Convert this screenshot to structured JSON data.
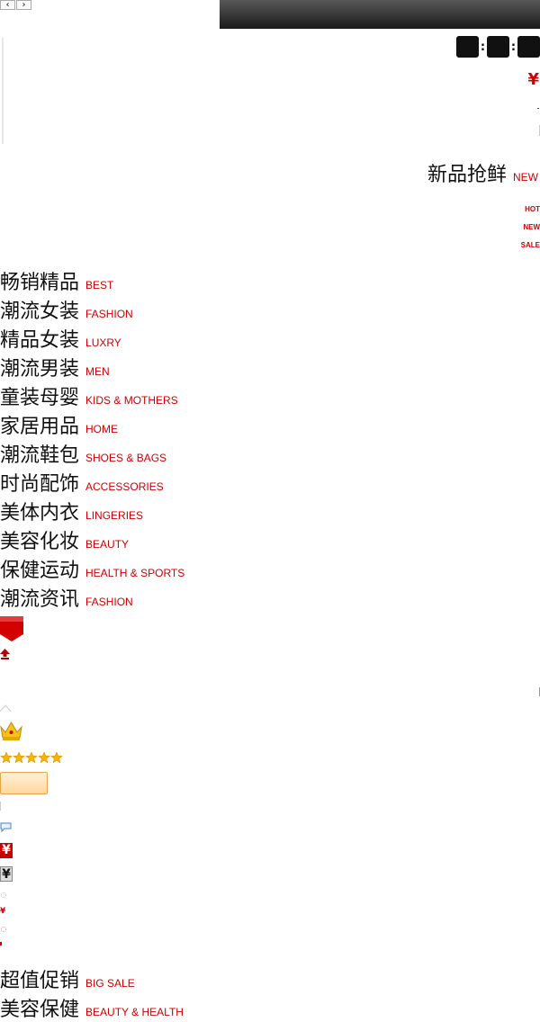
{
  "nav": {
    "prev": "‹",
    "next": "›"
  },
  "countdown": {
    "colon1": ":",
    "colon2": ":"
  },
  "price": {
    "currency": "¥"
  },
  "new_section": {
    "zh": "新品抢鲜",
    "en": "NEW",
    "tags": [
      "HOT",
      "NEW",
      "SALE"
    ]
  },
  "categories": [
    {
      "zh": "畅销精品",
      "en": "BEST"
    },
    {
      "zh": "潮流女装",
      "en": "FASHION"
    },
    {
      "zh": "精品女装",
      "en": "LUXRY"
    },
    {
      "zh": "潮流男装",
      "en": "MEN"
    },
    {
      "zh": "童装母婴",
      "en": "KIDS & MOTHERS"
    },
    {
      "zh": "家居用品",
      "en": "HOME"
    },
    {
      "zh": "潮流鞋包",
      "en": "SHOES & BAGS"
    },
    {
      "zh": "时尚配饰",
      "en": "ACCESSORIES"
    },
    {
      "zh": "美体内衣",
      "en": "LINGERIES"
    },
    {
      "zh": "美容化妆",
      "en": "BEAUTY"
    },
    {
      "zh": "保健运动",
      "en": "HEALTH & SPORTS"
    },
    {
      "zh": "潮流资讯",
      "en": "FASHION"
    }
  ],
  "sprites": {
    "yen_red": "¥",
    "yen_gray": "¥",
    "yen_small": "¥"
  },
  "bottom_categories": [
    {
      "zh": "超值促销",
      "en": "BIG SALE"
    },
    {
      "zh": "美容保健",
      "en": "BEAUTY & HEALTH"
    }
  ],
  "colors": {
    "accent_red": "#cc0000",
    "dark_bar_top": "#585858",
    "dark_bar_bottom": "#1a1a1a",
    "gold": "#f4b400"
  }
}
